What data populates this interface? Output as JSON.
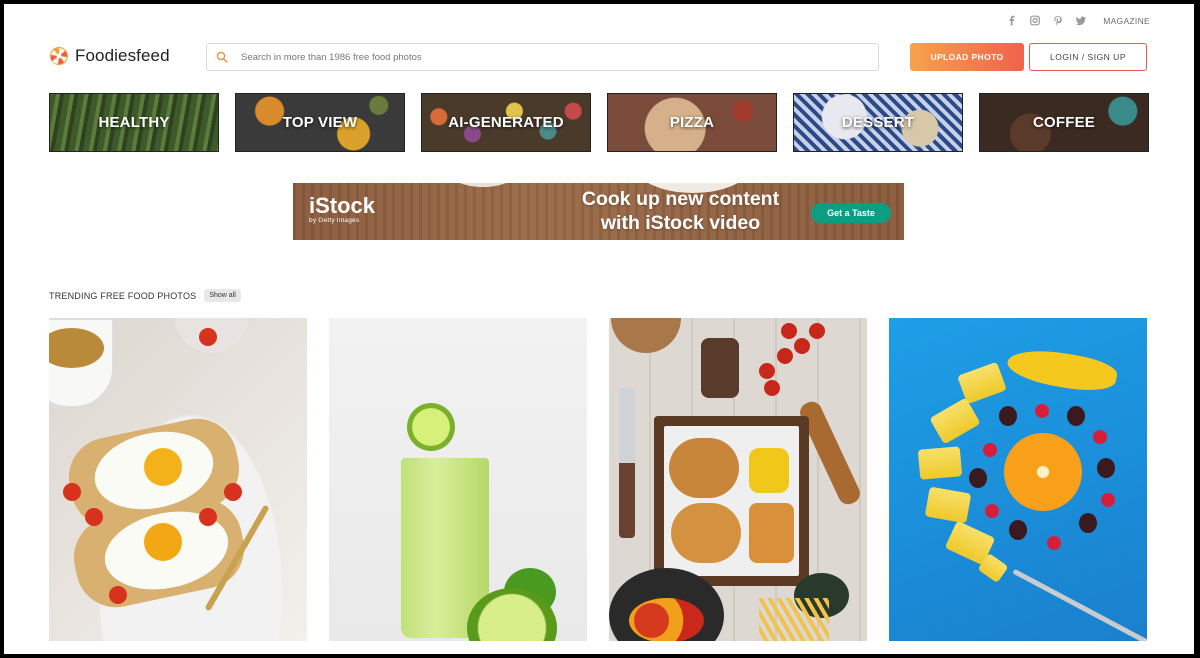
{
  "header": {
    "logo_text": "Foodiesfeed",
    "search_placeholder": "Search in more than 1986 free food photos",
    "upload_label": "UPLOAD PHOTO",
    "login_label": "LOGIN / SIGN UP",
    "magazine_label": "MAGAZINE",
    "social_icons": [
      "facebook-icon",
      "instagram-icon",
      "pinterest-icon",
      "twitter-icon"
    ]
  },
  "categories": [
    {
      "label": "HEALTHY"
    },
    {
      "label": "TOP VIEW"
    },
    {
      "label": "AI-GENERATED"
    },
    {
      "label": "PIZZA"
    },
    {
      "label": "DESSERT"
    },
    {
      "label": "COFFEE"
    }
  ],
  "ad": {
    "brand": "iStock",
    "brand_sub": "by Getty Images",
    "headline_line1": "Cook up new content",
    "headline_line2": "with iStock video",
    "cta": "Get a Taste"
  },
  "trending": {
    "title": "TRENDING FREE FOOD PHOTOS",
    "show_all": "Show all"
  },
  "colors": {
    "accent_gradient_start": "#f7a24a",
    "accent_gradient_end": "#f0624d",
    "login_border": "#e05a50",
    "ad_cta": "#0d9d82"
  }
}
